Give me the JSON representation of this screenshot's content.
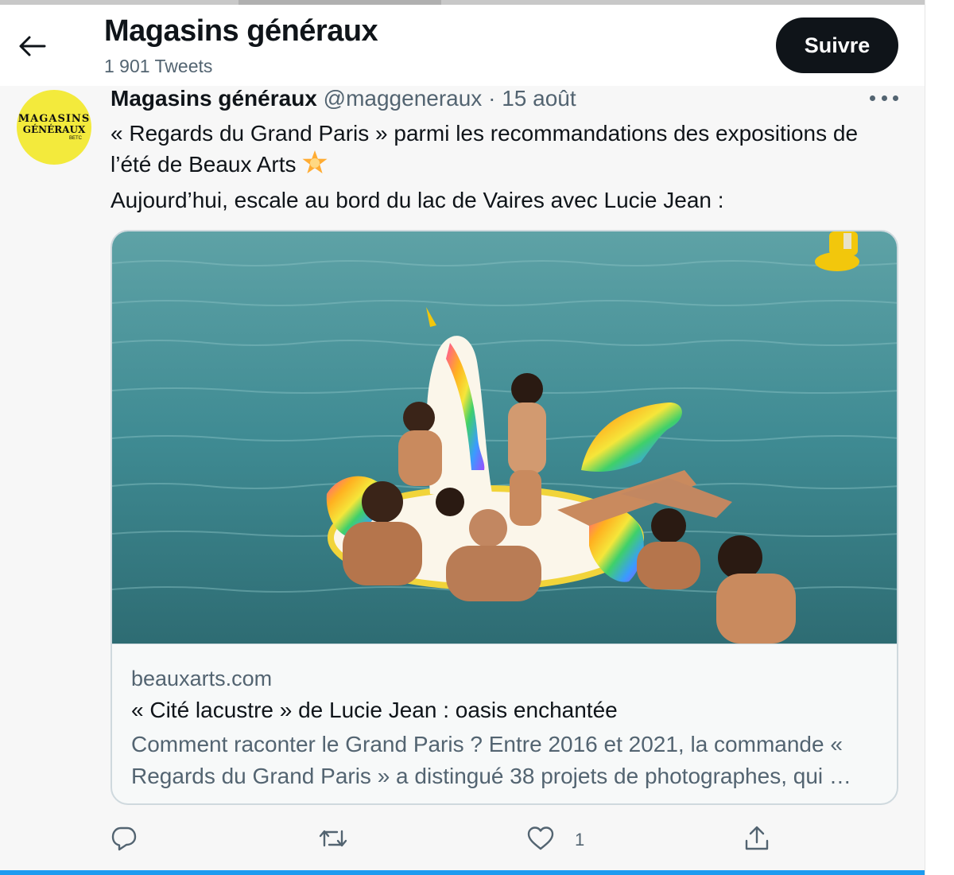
{
  "header": {
    "title": "Magasins généraux",
    "tweet_count": "1 901 Tweets",
    "follow_label": "Suivre"
  },
  "tweet": {
    "avatar": {
      "line1": "MAGASINS",
      "line2": "GÉNÉRAUX",
      "line3": "BETC"
    },
    "display_name": "Magasins généraux",
    "handle": "@maggeneraux",
    "separator": "·",
    "date": "15 août",
    "text_line1": "« Regards du Grand Paris » parmi les recommandations des expositions de",
    "text_line2": "l’été de Beaux Arts",
    "text_line3": "Aujourd’hui, escale au bord du lac de Vaires avec Lucie Jean :",
    "emoji": "star-emoji",
    "card": {
      "domain": "beauxarts.com",
      "title": "« Cité lacustre » de Lucie Jean : oasis enchantée",
      "description": "Comment raconter le Grand Paris ? Entre 2016 et 2021, la commande « Regards du Grand Paris » a distingué 38 projets de photographes, qui …",
      "image": "photo-people-swimming-with-inflatable-unicorn"
    },
    "actions": {
      "reply_icon": "reply-icon",
      "retweet_icon": "retweet-icon",
      "like_icon": "heart-icon",
      "like_count": "1",
      "share_icon": "share-icon"
    }
  },
  "colors": {
    "text": "#0f1419",
    "secondary": "#536471",
    "follow_bg": "#0f1419",
    "avatar_bg": "#f3ea3c",
    "accent": "#1d9bf0",
    "border": "#cfd9de"
  }
}
